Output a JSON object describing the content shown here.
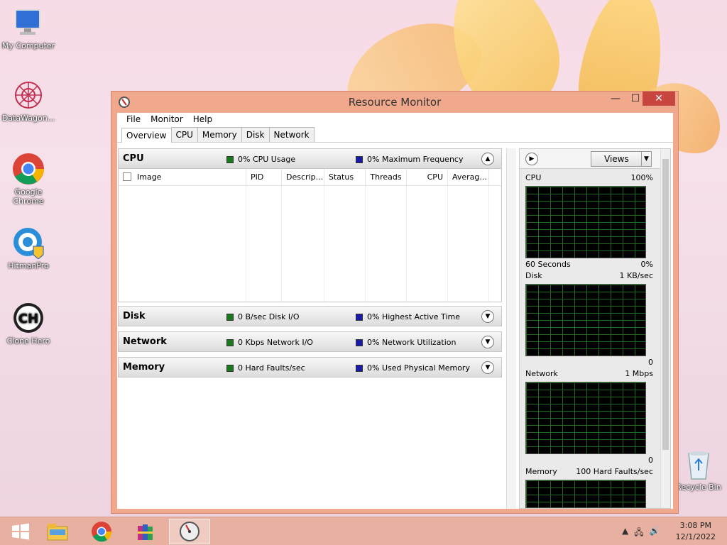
{
  "desktop": {
    "icons": [
      {
        "label": "My Computer"
      },
      {
        "label": "DataWagon..."
      },
      {
        "label": "Google Chrome"
      },
      {
        "label": "HitmanPro"
      },
      {
        "label": "Clone Hero"
      },
      {
        "label": "Recycle Bin"
      }
    ]
  },
  "window": {
    "title": "Resource Monitor",
    "controls": {
      "minimize": "—",
      "maximize": "☐",
      "close": "✕"
    },
    "menu": [
      "File",
      "Monitor",
      "Help"
    ],
    "tabs": [
      "Overview",
      "CPU",
      "Memory",
      "Disk",
      "Network"
    ],
    "active_tab": "Overview"
  },
  "sections": {
    "cpu": {
      "name": "CPU",
      "metric1": "0% CPU Usage",
      "metric2": "0% Maximum Frequency"
    },
    "disk": {
      "name": "Disk",
      "metric1": "0 B/sec Disk I/O",
      "metric2": "0% Highest Active Time"
    },
    "network": {
      "name": "Network",
      "metric1": "0 Kbps Network I/O",
      "metric2": "0% Network Utilization"
    },
    "memory": {
      "name": "Memory",
      "metric1": "0 Hard Faults/sec",
      "metric2": "0% Used Physical Memory"
    }
  },
  "cpu_table": {
    "columns": [
      "Image",
      "PID",
      "Descrip...",
      "Status",
      "Threads",
      "CPU",
      "Averag..."
    ]
  },
  "graphs": {
    "views_label": "Views",
    "cpu": {
      "title": "CPU",
      "max": "100%",
      "footer_left": "60 Seconds",
      "footer_right": "0%"
    },
    "disk": {
      "title": "Disk",
      "max": "1 KB/sec",
      "footer_right": "0"
    },
    "network": {
      "title": "Network",
      "max": "1 Mbps",
      "footer_right": "0"
    },
    "memory": {
      "title": "Memory",
      "max": "100 Hard Faults/sec"
    }
  },
  "taskbar": {
    "time": "3:08 PM",
    "date": "12/1/2022"
  }
}
